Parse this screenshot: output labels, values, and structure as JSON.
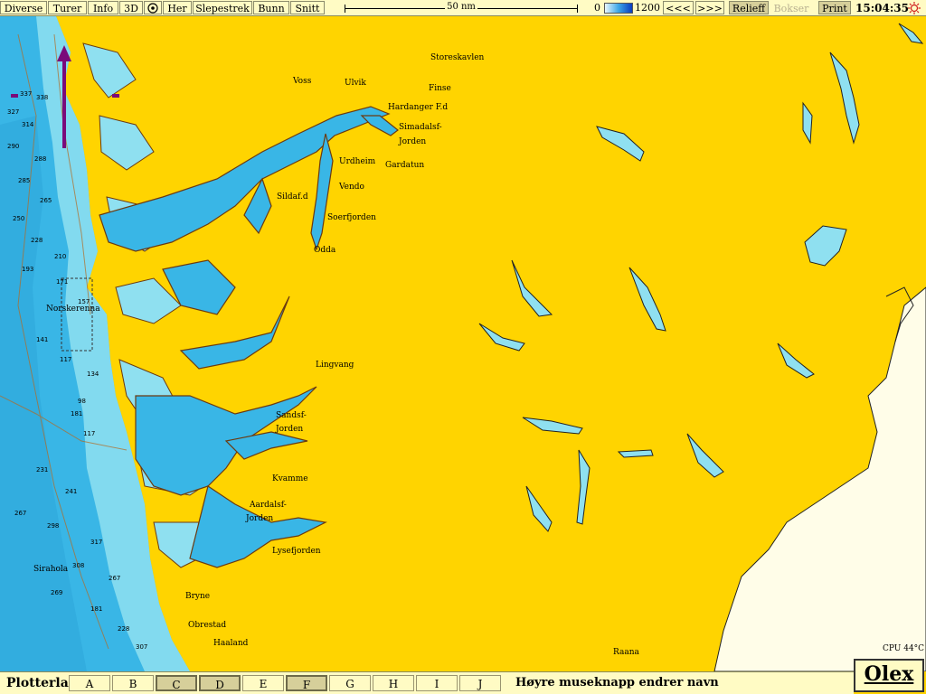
{
  "toolbar": {
    "buttons": [
      "Diverse",
      "Turer",
      "Info",
      "3D",
      "Her",
      "Slepestrek",
      "Bunn",
      "Snitt"
    ],
    "scale_label": "50 nm",
    "depth_min": "0",
    "depth_max": "1200",
    "prev_label": "<<<",
    "next_label": ">>>",
    "relieff_label": "Relieff",
    "bokser_label": "Bokser",
    "print_label": "Print",
    "clock": "15:04:35"
  },
  "map": {
    "place_names": [
      {
        "id": "voss",
        "text": "Voss"
      },
      {
        "id": "ulvik",
        "text": "Ulvik"
      },
      {
        "id": "storeskavlen",
        "text": "Storeskavlen"
      },
      {
        "id": "finse",
        "text": "Finse"
      },
      {
        "id": "hardanger",
        "text": "Hardanger F.d"
      },
      {
        "id": "simadal1",
        "text": "Simadalsf-"
      },
      {
        "id": "simadal2",
        "text": "Jorden"
      },
      {
        "id": "urdheim",
        "text": "Urdheim"
      },
      {
        "id": "gardatun",
        "text": "Gardatun"
      },
      {
        "id": "vendo",
        "text": "Vendo"
      },
      {
        "id": "sildaf",
        "text": "Sildaf.d"
      },
      {
        "id": "soerfjorden",
        "text": "Soerfjorden"
      },
      {
        "id": "odda",
        "text": "Odda"
      },
      {
        "id": "norskerenna",
        "text": "Norskerenna"
      },
      {
        "id": "lingvang",
        "text": "Lingvang"
      },
      {
        "id": "sandsf1",
        "text": "Sandsf-"
      },
      {
        "id": "sandsf2",
        "text": "Jorden"
      },
      {
        "id": "kvamme",
        "text": "Kvamme"
      },
      {
        "id": "aardal1",
        "text": "Aardalsf-"
      },
      {
        "id": "aardal2",
        "text": "Jorden"
      },
      {
        "id": "lysefjorden",
        "text": "Lysefjorden"
      },
      {
        "id": "sirahola",
        "text": "Sirahola"
      },
      {
        "id": "bryne",
        "text": "Bryne"
      },
      {
        "id": "obrestad",
        "text": "Obrestad"
      },
      {
        "id": "haaland",
        "text": "Haaland"
      },
      {
        "id": "raana",
        "text": "Raana"
      }
    ],
    "depth_soundings": [
      "337",
      "338",
      "327",
      "314",
      "290",
      "288",
      "285",
      "265",
      "250",
      "228",
      "210",
      "193",
      "171",
      "157",
      "141",
      "117",
      "134",
      "98",
      "181",
      "117",
      "231",
      "241",
      "267",
      "298",
      "317",
      "308",
      "267",
      "269",
      "181",
      "228",
      "307"
    ],
    "cpu_label": "CPU 44°C"
  },
  "bottombar": {
    "title": "Plotterlag",
    "layers": [
      "A",
      "B",
      "C",
      "D",
      "E",
      "F",
      "G",
      "H",
      "I",
      "J"
    ],
    "active_layers": [
      "C",
      "D",
      "F"
    ],
    "hint": "Høyre museknapp endrer navn"
  },
  "brand": "Olex",
  "colors": {
    "land": "#ffd400",
    "shallow_water": "#8fe0f0",
    "deep_water": "#39b6e6",
    "toolbar": "#fffbc4"
  }
}
